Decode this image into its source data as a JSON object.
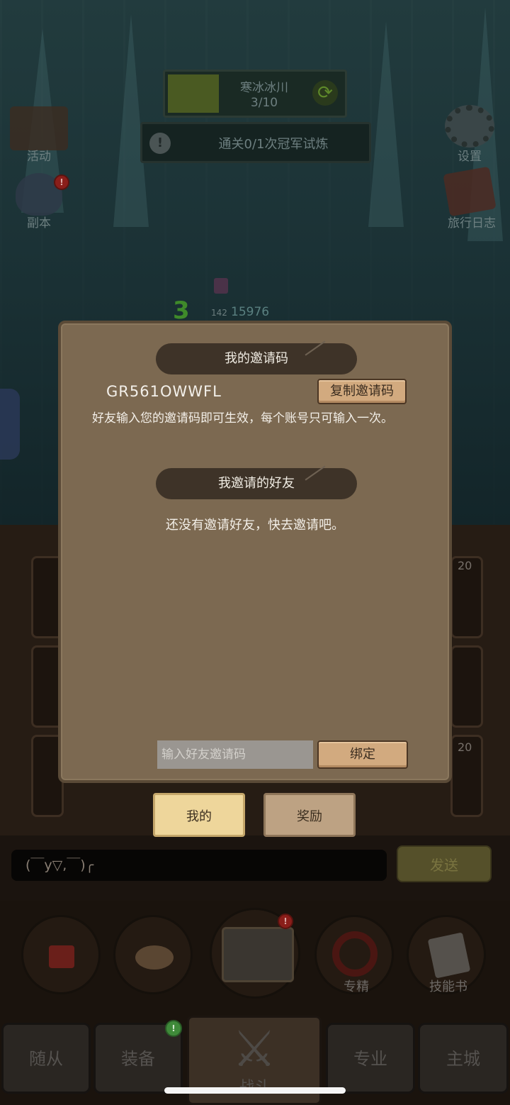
{
  "hud": {
    "stage_name": "寒冰冰川",
    "stage_progress": "3/10",
    "quest_text": "通关0/1次冠军试炼",
    "left_menu": [
      "活动",
      "副本"
    ],
    "right_menu": [
      "设置",
      "旅行日志"
    ],
    "hero_power": "15976",
    "hero_level": "142",
    "combo_number": "3",
    "slot_level": "20"
  },
  "invite_dialog": {
    "my_code_header": "我的邀请码",
    "invite_code": "GR561OWWFL",
    "copy_button": "复制邀请码",
    "description": "好友输入您的邀请码即可生效，每个账号只可输入一次。",
    "friends_header": "我邀请的好友",
    "empty_text": "还没有邀请好友，快去邀请吧。",
    "code_input_placeholder": "输入好友邀请码",
    "bind_button": "绑定"
  },
  "dialog_tabs": [
    {
      "label": "我的",
      "active": true
    },
    {
      "label": "奖励",
      "active": false
    }
  ],
  "chat": {
    "input_text": "(￣y▽,￣)╭",
    "send_button": "发送"
  },
  "quick_actions": [
    "专精",
    "技能书"
  ],
  "bottom_nav": [
    "随从",
    "装备",
    "战斗",
    "专业",
    "主城"
  ],
  "colors": {
    "dialog_bg": "#7c6951",
    "header_pill": "#3e3328",
    "plank_button": "#d2aa7f",
    "active_tab": "#eed69b",
    "badge_red": "#8a1e1a",
    "badge_green": "#3f8a3a"
  }
}
